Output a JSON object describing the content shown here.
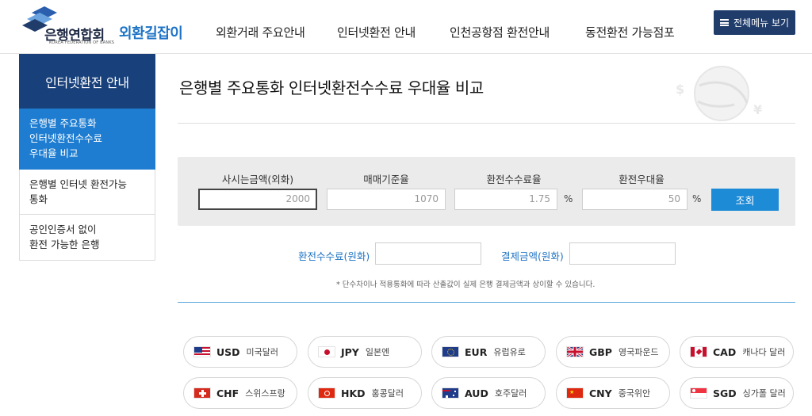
{
  "header": {
    "logo_text": "은행연합회",
    "logo_sub": "KOREA FEDERATION OF BANKS",
    "logo_accent": "외환길잡이",
    "nav": [
      "외환거래 주요안내",
      "인터넷환전 안내",
      "인천공항점 환전안내",
      "동전환전 가능점포"
    ],
    "menu_button": "전체메뉴 보기"
  },
  "sidebar": {
    "title": "인터넷환전 안내",
    "items": [
      {
        "label": "은행별 주요통화\n인터넷환전수수료\n우대율 비교",
        "active": true
      },
      {
        "label": "은행별 인터넷 환전가능\n통화",
        "active": false
      },
      {
        "label": "공인인증서 없이\n환전 가능한 은행",
        "active": false
      }
    ]
  },
  "page": {
    "title": "은행별 주요통화 인터넷환전수수료 우대율 비교"
  },
  "calculator": {
    "labels": [
      "사시는금액(외화)",
      "매매기준율",
      "환전수수료율",
      "환전우대율"
    ],
    "values": [
      "2000",
      "1070",
      "1.75",
      "50"
    ],
    "percent": "%",
    "search_button": "조회"
  },
  "result": {
    "fee_label": "환전수수료(원화)",
    "payment_label": "결제금액(원화)",
    "fee_value": "",
    "payment_value": "",
    "note": "* 단수차이나 적용통화에 따라 산출값이 실제 은행 결제금액과 상이할 수 있습니다."
  },
  "currencies": [
    {
      "code": "USD",
      "name": "미국달러",
      "flag": "us-flag-icon"
    },
    {
      "code": "JPY",
      "name": "일본엔",
      "flag": "jp-flag-icon"
    },
    {
      "code": "EUR",
      "name": "유럽유로",
      "flag": "eu-flag-icon"
    },
    {
      "code": "GBP",
      "name": "영국파운드",
      "flag": "gb-flag-icon"
    },
    {
      "code": "CAD",
      "name": "캐나다 달러",
      "flag": "ca-flag-icon"
    },
    {
      "code": "CHF",
      "name": "스위스프랑",
      "flag": "ch-flag-icon"
    },
    {
      "code": "HKD",
      "name": "홍콩달러",
      "flag": "hk-flag-icon"
    },
    {
      "code": "AUD",
      "name": "호주달러",
      "flag": "au-flag-icon"
    },
    {
      "code": "CNY",
      "name": "중국위안",
      "flag": "cn-flag-icon"
    },
    {
      "code": "SGD",
      "name": "싱가폴 달러",
      "flag": "sg-flag-icon"
    }
  ],
  "colors": {
    "navy": "#18417c",
    "accent_blue": "#1e7dd1",
    "button_blue": "#1e8bd6",
    "menu_button": "#1f3c6b",
    "label_blue": "#1e73c4"
  }
}
